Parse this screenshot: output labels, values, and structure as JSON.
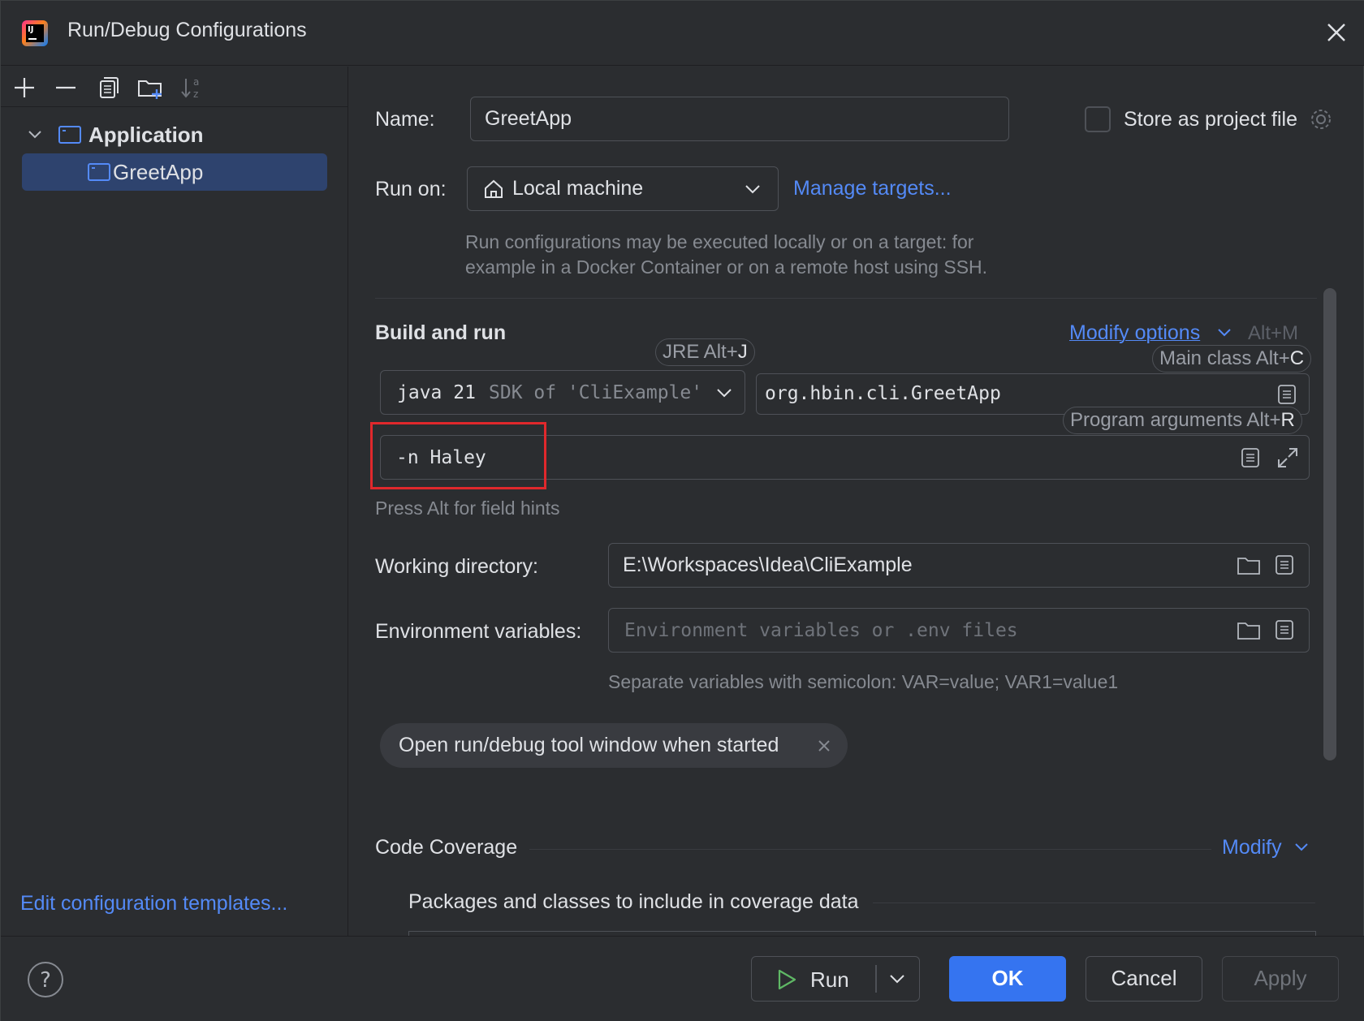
{
  "window": {
    "title": "Run/Debug Configurations",
    "logo_text": "IJ"
  },
  "sidebar": {
    "toolbar": [
      "add-icon",
      "remove-icon",
      "copy-icon",
      "new-folder-icon",
      "sort-icon"
    ],
    "tree": [
      {
        "label": "Application",
        "expanded": true
      },
      {
        "label": "GreetApp",
        "selected": true
      }
    ],
    "edit_templates_link": "Edit configuration templates..."
  },
  "form": {
    "name_label": "Name:",
    "name_value": "GreetApp",
    "store_label": "Store as project file",
    "store_checked": false,
    "run_on_label": "Run on:",
    "run_on_value": "Local machine",
    "manage_targets_link": "Manage targets...",
    "run_on_hint_line1": "Run configurations may be executed locally or on a target: for",
    "run_on_hint_line2": "example in a Docker Container or on a remote host using SSH.",
    "build_run_header": "Build and run",
    "modify_options_link": "Modify options",
    "modify_options_shortcut": "Alt+M",
    "jre_tip_text": "JRE Alt+",
    "jre_tip_key": "J",
    "sdk_value": "java 21",
    "sdk_hint": "SDK of 'CliExample'",
    "main_class_tip_text": "Main class Alt+",
    "main_class_tip_key": "C",
    "main_class_value": "org.hbin.cli.GreetApp",
    "program_args_tip_text": "Program arguments Alt+",
    "program_args_tip_key": "R",
    "program_args_value": "-n Haley",
    "field_hints_text": "Press Alt for field hints",
    "working_dir_label": "Working directory:",
    "working_dir_value": "E:\\Workspaces\\Idea\\CliExample",
    "env_label": "Environment variables:",
    "env_placeholder": "Environment variables or .env files",
    "env_hint": "Separate variables with semicolon: VAR=value; VAR1=value1",
    "option_chip": "Open run/debug tool window when started",
    "coverage_header": "Code Coverage",
    "coverage_modify_link": "Modify",
    "coverage_packages_header": "Packages and classes to include in coverage data"
  },
  "footer": {
    "help": "?",
    "run_label": "Run",
    "ok_label": "OK",
    "cancel_label": "Cancel",
    "apply_label": "Apply"
  },
  "colors": {
    "accent": "#3574f0",
    "link": "#548af7",
    "highlight_box": "#e0282c",
    "selection": "#2e436e"
  }
}
